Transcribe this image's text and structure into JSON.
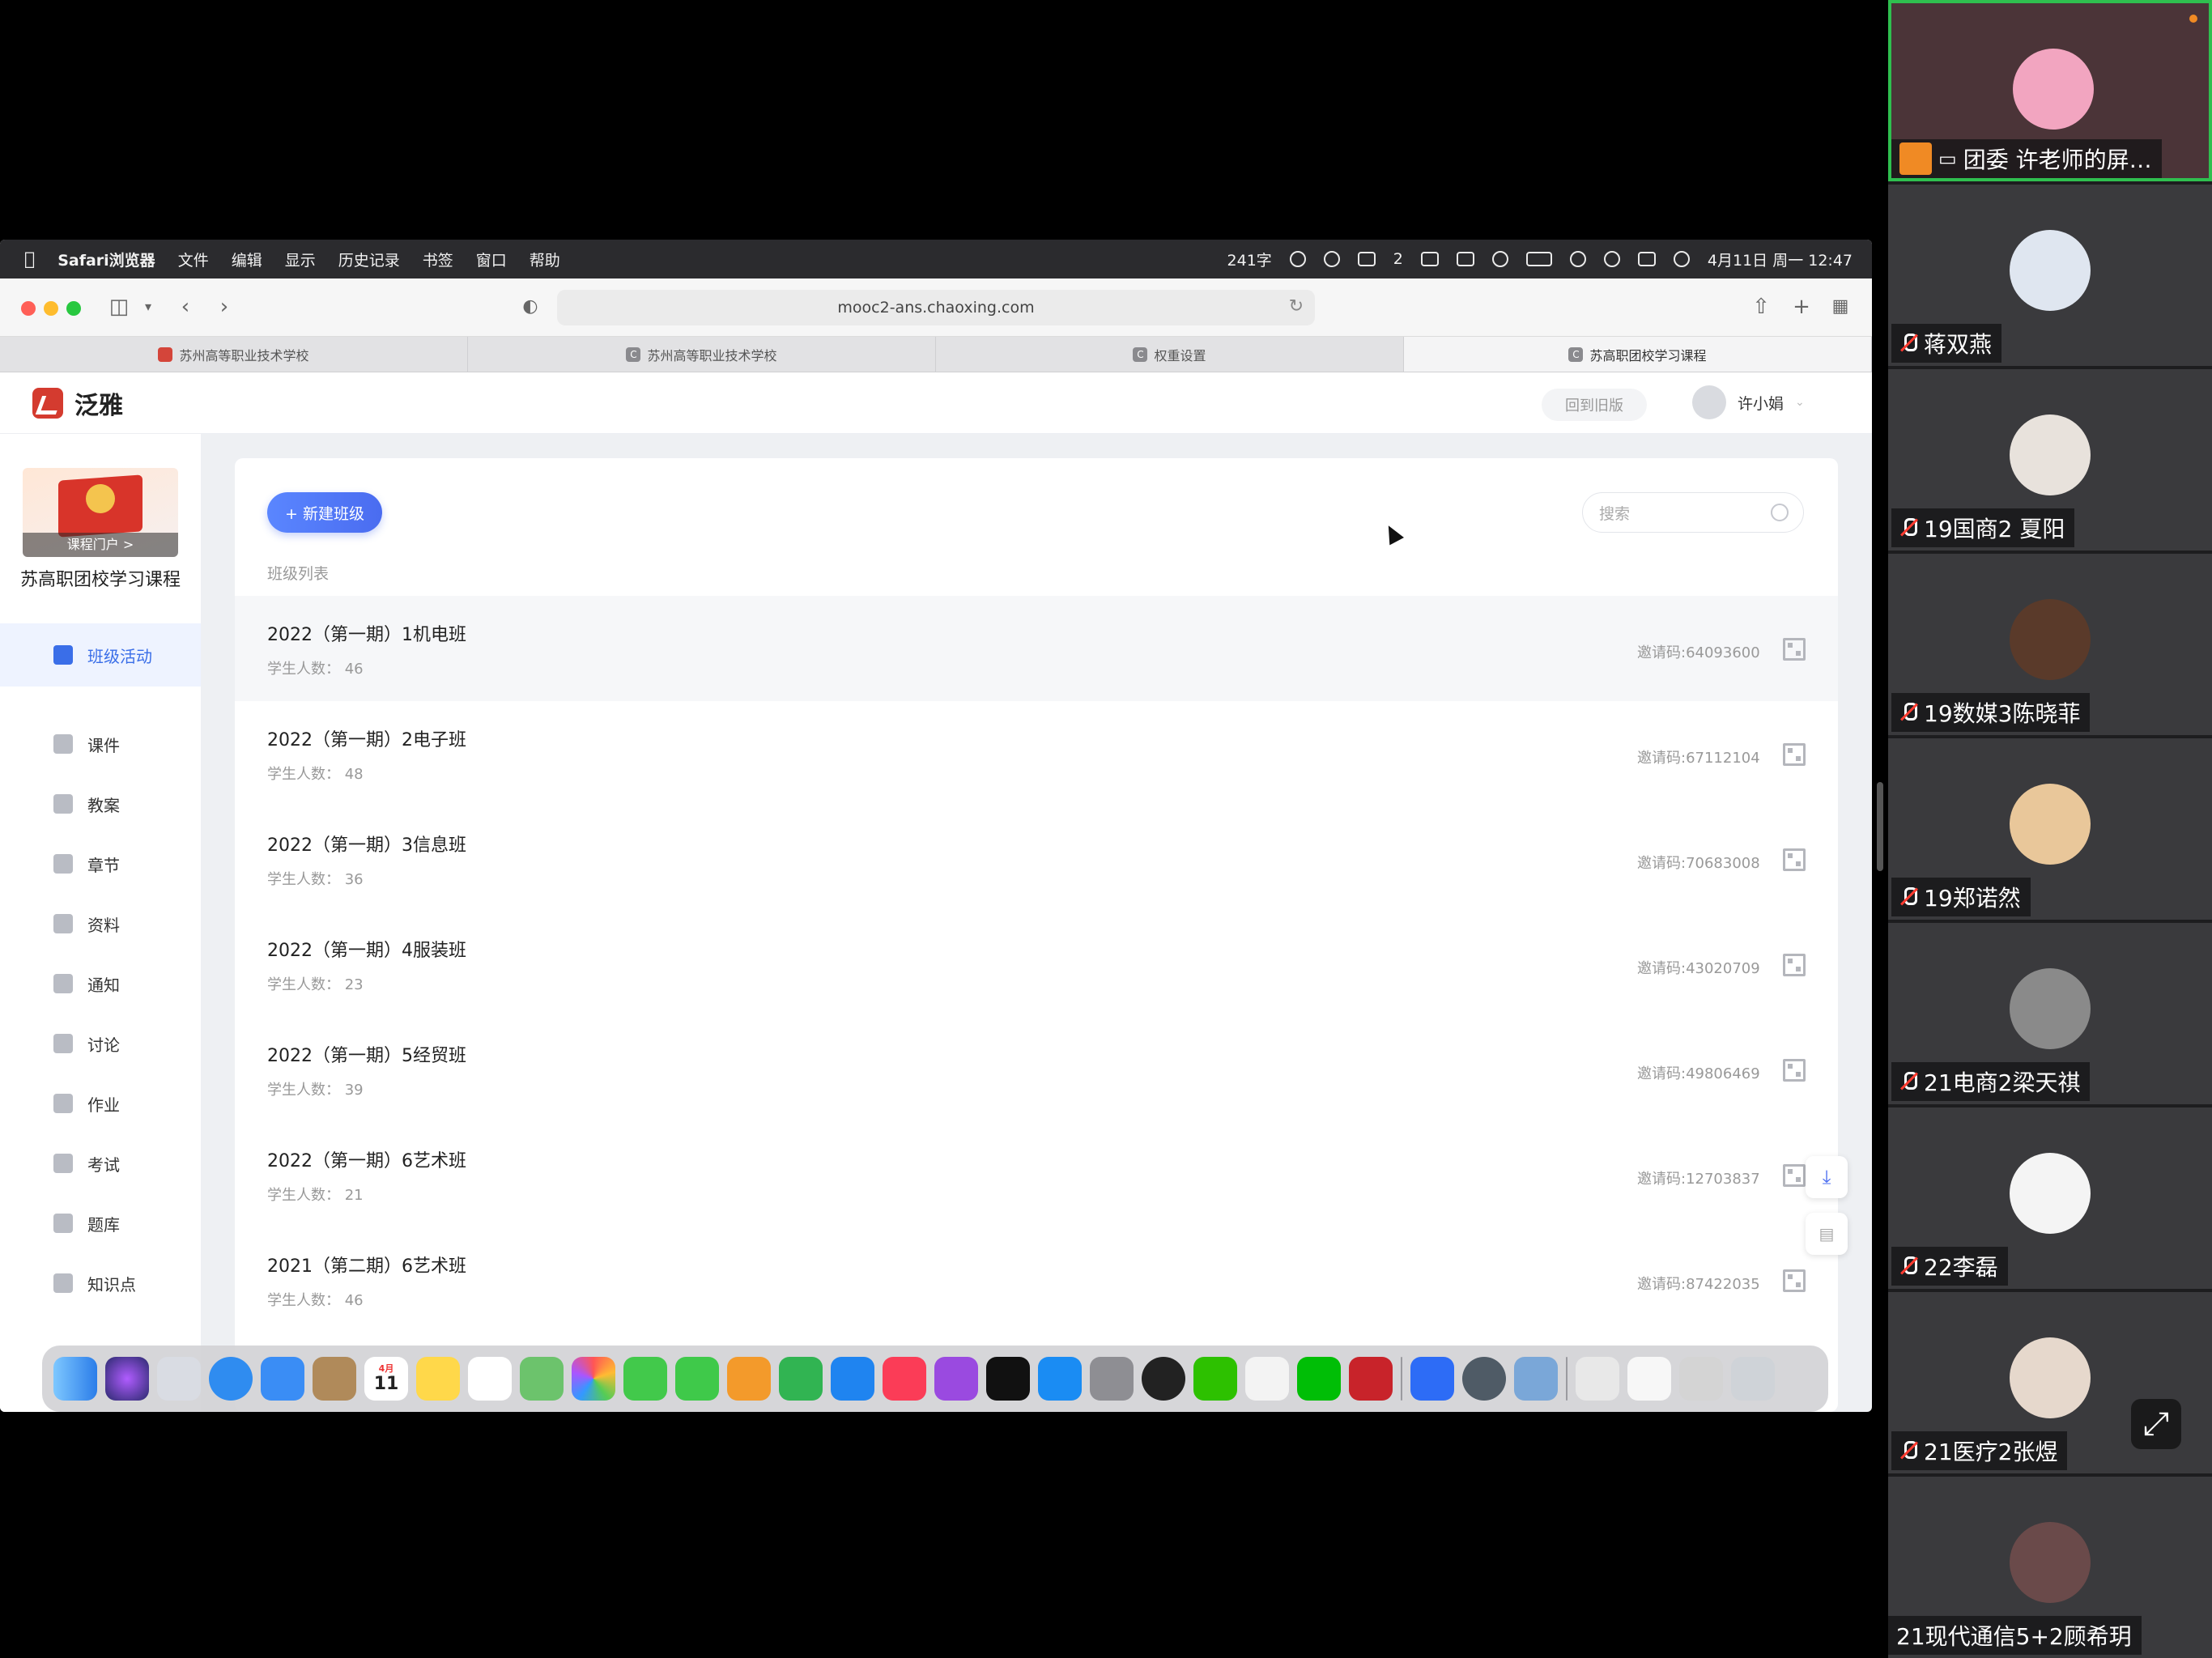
{
  "menubar": {
    "app": "Safari浏览器",
    "items": [
      "文件",
      "编辑",
      "显示",
      "历史记录",
      "书签",
      "窗口",
      "帮助"
    ],
    "word_count": "241字",
    "notif_count": "2",
    "datetime": "4月11日 周一 12:47"
  },
  "browser": {
    "url": "mooc2-ans.chaoxing.com",
    "tabs": [
      {
        "label": "苏州高等职业技术学校",
        "active": false
      },
      {
        "label": "苏州高等职业技术学校",
        "active": false
      },
      {
        "label": "权重设置",
        "active": false
      },
      {
        "label": "苏高职团校学习课程",
        "active": true
      }
    ]
  },
  "header": {
    "logo": "泛雅",
    "old_version": "回到旧版",
    "user": "许小娟"
  },
  "sidebar": {
    "portal_label": "课程门户 >",
    "course_title": "苏高职团校学习课程",
    "items": [
      {
        "label": "班级活动",
        "active": true
      },
      {
        "label": "课件"
      },
      {
        "label": "教案"
      },
      {
        "label": "章节"
      },
      {
        "label": "资料"
      },
      {
        "label": "通知"
      },
      {
        "label": "讨论"
      },
      {
        "label": "作业"
      },
      {
        "label": "考试"
      },
      {
        "label": "题库"
      },
      {
        "label": "知识点"
      }
    ]
  },
  "main": {
    "new_class": "+ 新建班级",
    "search_placeholder": "搜索",
    "list_label": "班级列表",
    "count_prefix": "学生人数：",
    "classes": [
      {
        "name": "2022（第一期）1机电班",
        "count": "46",
        "code": "邀请码:64093600"
      },
      {
        "name": "2022（第一期）2电子班",
        "count": "48",
        "code": "邀请码:67112104"
      },
      {
        "name": "2022（第一期）3信息班",
        "count": "36",
        "code": "邀请码:70683008"
      },
      {
        "name": "2022（第一期）4服装班",
        "count": "23",
        "code": "邀请码:43020709"
      },
      {
        "name": "2022（第一期）5经贸班",
        "count": "39",
        "code": "邀请码:49806469"
      },
      {
        "name": "2022（第一期）6艺术班",
        "count": "21",
        "code": "邀请码:12703837"
      },
      {
        "name": "2021（第二期）6艺术班",
        "count": "46",
        "code": "邀请码:87422035"
      }
    ]
  },
  "dock": {
    "calendar_month": "4月",
    "calendar_day": "11",
    "apps": [
      "finder-icon",
      "siri-icon",
      "launchpad-icon",
      "safari-icon",
      "mail-icon",
      "contacts-icon",
      "calendar-icon",
      "notes-icon",
      "reminders-icon",
      "maps-icon",
      "photos-icon",
      "messages-icon",
      "facetime-icon",
      "pages-icon",
      "numbers-icon",
      "keynote-icon",
      "music-icon",
      "podcasts-icon",
      "tv-icon",
      "appstore-icon",
      "settings-icon",
      "qq-icon",
      "wechat-icon",
      "textedit-icon",
      "iqiyi-icon",
      "autocad-icon",
      "tencent-meeting-icon",
      "quicktime-icon",
      "preview-icon",
      "folder-icon",
      "doc-icon",
      "screenshot-icon",
      "trash-icon"
    ]
  },
  "participants": [
    {
      "name": "团委 许老师的屏…",
      "muted": false,
      "sharing": true
    },
    {
      "name": "蒋双燕",
      "muted": true
    },
    {
      "name": "19国商2 夏阳",
      "muted": true
    },
    {
      "name": "19数媒3陈晓菲",
      "muted": true
    },
    {
      "name": "19郑诺然",
      "muted": true
    },
    {
      "name": "21电商2梁天祺",
      "muted": true
    },
    {
      "name": "22李磊",
      "muted": true
    },
    {
      "name": "21医疗2张煜",
      "muted": true
    },
    {
      "name": "21现代通信5+2顾希玥",
      "muted": false
    }
  ],
  "colors": {
    "accent": "#4a6cf0",
    "active_nav_bg": "#eef3ff",
    "speaking_border": "#2fbf4f"
  }
}
